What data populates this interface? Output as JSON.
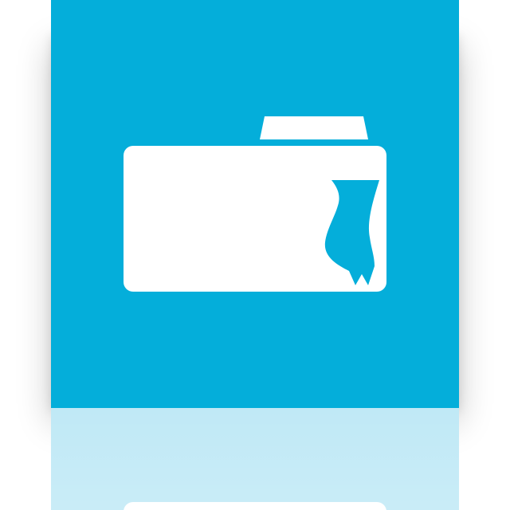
{
  "icon": {
    "name": "bookmarked-folder-icon",
    "tile_color": "#04AEDA",
    "glyph_color": "#FFFFFF",
    "reflection_color": "#C0E9F6"
  }
}
